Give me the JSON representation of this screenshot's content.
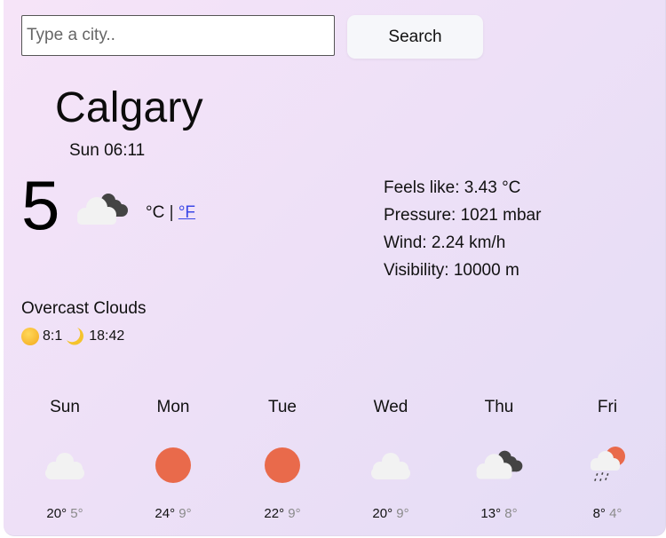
{
  "search": {
    "placeholder": "Type a city..",
    "value": "",
    "button_label": "Search"
  },
  "current": {
    "city": "Calgary",
    "datetime": "Sun 06:11",
    "temperature": "5",
    "icon": "overcast-clouds-icon",
    "unit_celsius": "°C",
    "unit_separator": "|",
    "unit_fahrenheit": "°F",
    "description": "Overcast Clouds",
    "sunrise": "8:1",
    "sunset": "18:42"
  },
  "details": {
    "feels_like": "Feels like: 3.43 °C",
    "pressure": "Pressure: 1021 mbar",
    "wind": "Wind: 2.24 km/h",
    "visibility": "Visibility: 10000 m"
  },
  "forecast": [
    {
      "day": "Sun",
      "icon": "cloud-icon",
      "high": "20°",
      "low": "5°"
    },
    {
      "day": "Mon",
      "icon": "sun-icon",
      "high": "24°",
      "low": "9°"
    },
    {
      "day": "Tue",
      "icon": "sun-icon",
      "high": "22°",
      "low": "9°"
    },
    {
      "day": "Wed",
      "icon": "cloud-icon",
      "high": "20°",
      "low": "9°"
    },
    {
      "day": "Thu",
      "icon": "overcast-clouds-icon",
      "high": "13°",
      "low": "8°"
    },
    {
      "day": "Fri",
      "icon": "rain-sun-icon",
      "high": "8°",
      "low": "4°"
    }
  ],
  "colors": {
    "sun": "#e96a4b",
    "cloud_light": "#f2f2f2",
    "cloud_dark": "#444444",
    "link": "#3b48e6"
  }
}
